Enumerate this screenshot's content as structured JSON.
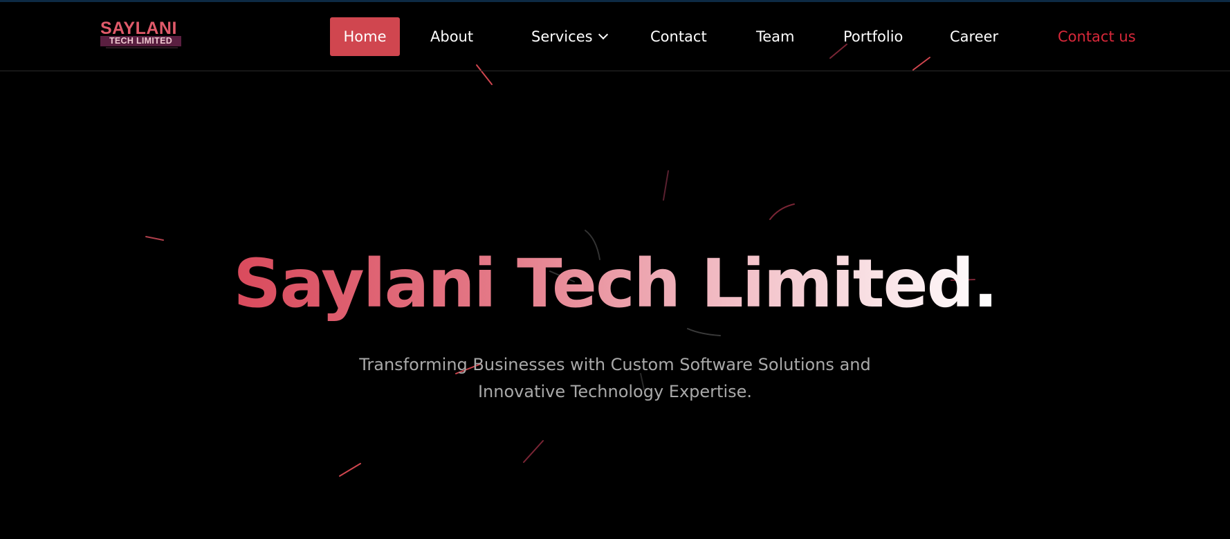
{
  "brand": {
    "logo_top": "SAYLANI",
    "logo_bottom": "TECH LIMITED"
  },
  "nav": {
    "home": "Home",
    "about": "About",
    "services": "Services",
    "contact": "Contact",
    "team": "Team",
    "portfolio": "Portfolio",
    "career": "Career",
    "contact_us": "Contact us"
  },
  "hero": {
    "title": "Saylani Tech Limited.",
    "subtitle_line1": "Transforming Businesses with Custom Software Solutions and",
    "subtitle_line2": "Innovative Technology Expertise."
  },
  "colors": {
    "accent": "#d0464f",
    "contact_us": "#d8283a",
    "background": "#000000"
  }
}
